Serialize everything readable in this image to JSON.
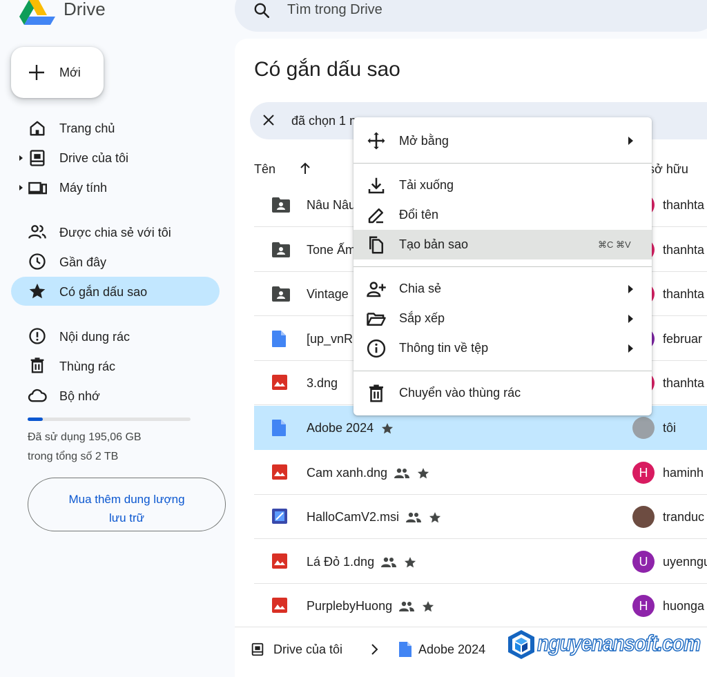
{
  "header": {
    "logo_text": "Drive",
    "search_placeholder": "Tìm trong Drive"
  },
  "sidebar": {
    "new_label": "Mới",
    "items": [
      {
        "label": "Trang chủ",
        "icon": "home-icon"
      },
      {
        "label": "Drive của tôi",
        "icon": "my-drive-icon",
        "expandable": true
      },
      {
        "label": "Máy tính",
        "icon": "computer-icon",
        "expandable": true
      },
      {
        "label": "Được chia sẻ với tôi",
        "icon": "shared-icon"
      },
      {
        "label": "Gần đây",
        "icon": "clock-icon"
      },
      {
        "label": "Có gắn dấu sao",
        "icon": "star-icon",
        "active": true
      },
      {
        "label": "Nội dung rác",
        "icon": "spam-icon"
      },
      {
        "label": "Thùng rác",
        "icon": "trash-icon"
      },
      {
        "label": "Bộ nhớ",
        "icon": "cloud-icon"
      }
    ],
    "storage_used_fraction": 0.095,
    "storage_line1": "Đã sử dụng 195,06 GB",
    "storage_line2": "trong tổng số 2 TB",
    "buy_line1": "Mua thêm dung lượng",
    "buy_line2": "lưu trữ"
  },
  "main": {
    "title": "Có gắn dấu sao",
    "selection_text": "đã chọn 1 m",
    "col_name": "Tên",
    "col_owner": "ủ sở hữu",
    "rows": [
      {
        "name": "Nâu Nâu",
        "type": "folder",
        "owner": "thanhta",
        "avatar_color": "#d81b60",
        "avatar_letter": ""
      },
      {
        "name": "Tone Ấm",
        "type": "folder",
        "owner": "thanhta",
        "avatar_color": "#d81b60",
        "avatar_letter": ""
      },
      {
        "name": "Vintage",
        "type": "folder",
        "owner": "thanhta",
        "avatar_color": "#d81b60",
        "avatar_letter": ""
      },
      {
        "name": "[up_vnR",
        "type": "doc",
        "owner": "februar",
        "avatar_color": "#7b1fa2",
        "avatar_letter": ""
      },
      {
        "name": "3.dng",
        "type": "image",
        "owner": "thanhta",
        "avatar_color": "#d81b60",
        "avatar_letter": ""
      },
      {
        "name": "Adobe 2024",
        "type": "doc",
        "owner": "tôi",
        "avatar_color": "#9aa0a6",
        "avatar_letter": "",
        "selected": true,
        "starred": true
      },
      {
        "name": "Cam xanh.dng",
        "type": "image",
        "owner": "haminh",
        "avatar_color": "#d81b60",
        "avatar_letter": "H",
        "shared": true,
        "starred": true
      },
      {
        "name": "HalloCamV2.msi",
        "type": "msi",
        "owner": "tranduc",
        "avatar_color": "#6d4c41",
        "avatar_letter": "",
        "shared": true,
        "starred": true
      },
      {
        "name": "Lá Đỏ 1.dng",
        "type": "image",
        "owner": "uyenngu",
        "avatar_color": "#8e24aa",
        "avatar_letter": "U",
        "shared": true,
        "starred": true
      },
      {
        "name": "PurplebyHuong",
        "type": "image",
        "owner": "huonga",
        "avatar_color": "#8e24aa",
        "avatar_letter": "H",
        "shared": true,
        "starred": true
      }
    ]
  },
  "breadcrumb": {
    "item1": "Drive của tôi",
    "item2": "Adobe 2024"
  },
  "watermark": "nguyenansoft.com",
  "context_menu": {
    "items": [
      {
        "label": "Mở bằng",
        "icon": "open-with-icon",
        "submenu": true
      },
      {
        "label": "Tải xuống",
        "icon": "download-icon"
      },
      {
        "label": "Đổi tên",
        "icon": "rename-icon"
      },
      {
        "label": "Tạo bản sao",
        "icon": "copy-icon",
        "shortcut": "⌘C ⌘V",
        "hovered": true
      },
      {
        "label": "Chia sẻ",
        "icon": "share-icon",
        "submenu": true
      },
      {
        "label": "Sắp xếp",
        "icon": "organize-icon",
        "submenu": true
      },
      {
        "label": "Thông tin về tệp",
        "icon": "info-icon",
        "submenu": true
      },
      {
        "label": "Chuyển vào thùng rác",
        "icon": "trash-icon"
      }
    ]
  },
  "colors": {
    "accent": "#0b57d0",
    "selected_bg": "#c2e7ff",
    "folder": "#444746",
    "doc": "#4285f4",
    "image": "#d93025"
  }
}
